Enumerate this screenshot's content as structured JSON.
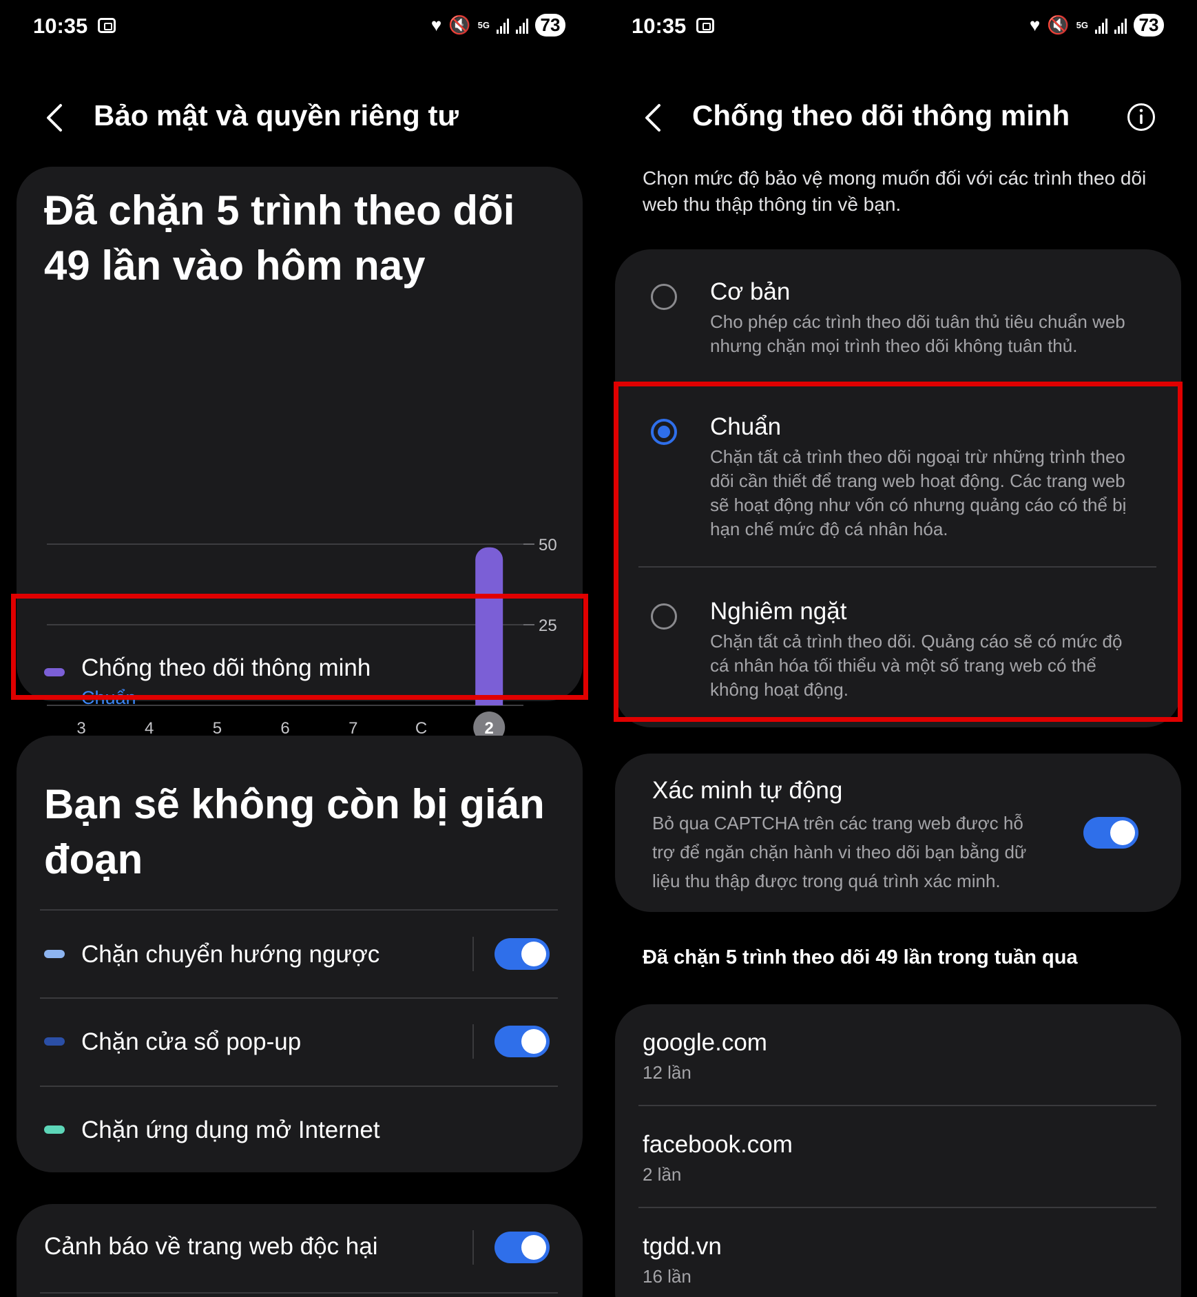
{
  "status": {
    "time": "10:35",
    "battery": "73",
    "network": "5G"
  },
  "left": {
    "header_title": "Bảo mật và quyền riêng tư",
    "card1": {
      "title": "Đã chặn 5 trình theo dõi 49 lần vào hôm nay",
      "feature_label": "Chống theo dõi thông minh",
      "feature_value": "Chuẩn"
    },
    "card2": {
      "title": "Bạn sẽ không còn bị gián đoạn",
      "items": [
        {
          "label": "Chặn chuyển hướng ngược",
          "color": "#8db4f0",
          "toggle": true
        },
        {
          "label": "Chặn cửa sổ pop-up",
          "color": "#2b4fa6",
          "toggle": true
        },
        {
          "label": "Chặn ứng dụng mở Internet",
          "color": "#5dd6b8"
        }
      ]
    },
    "card3": {
      "label": "Cảnh báo về trang web độc hại",
      "toggle": true
    }
  },
  "chart_data": {
    "type": "bar",
    "categories": [
      "3",
      "4",
      "5",
      "6",
      "7",
      "C",
      "2"
    ],
    "values": [
      0,
      0,
      0,
      0,
      0,
      0,
      49
    ],
    "highlighted_category": "2",
    "yticks": [
      25,
      50
    ],
    "ylim": [
      0,
      50
    ],
    "bar_color": "#7b5fd6",
    "grid": true
  },
  "right": {
    "header_title": "Chống theo dõi thông minh",
    "description": "Chọn mức độ bảo vệ mong muốn đối với các trình theo dõi web thu thập thông tin về bạn.",
    "options": [
      {
        "title": "Cơ bản",
        "desc": "Cho phép các trình theo dõi tuân thủ tiêu chuẩn web nhưng chặn mọi trình theo dõi không tuân thủ.",
        "selected": false
      },
      {
        "title": "Chuẩn",
        "desc": "Chặn tất cả trình theo dõi ngoại trừ những trình theo dõi cần thiết để trang web hoạt động. Các trang web sẽ hoạt động như vốn có nhưng quảng cáo có thể bị hạn chế mức độ cá nhân hóa.",
        "selected": true
      },
      {
        "title": "Nghiêm ngặt",
        "desc": "Chặn tất cả trình theo dõi. Quảng cáo sẽ có mức độ cá nhân hóa tối thiểu và một số trang web có thể không hoạt động.",
        "selected": false
      }
    ],
    "auto_verify": {
      "title": "Xác minh tự động",
      "desc": "Bỏ qua CAPTCHA trên các trang web được hỗ trợ để ngăn chặn hành vi theo dõi bạn bằng dữ liệu thu thập được trong quá trình xác minh.",
      "toggle": true
    },
    "week_heading": "Đã chặn 5 trình theo dõi 49 lần trong tuần qua",
    "sites": [
      {
        "domain": "google.com",
        "count": "12 lần"
      },
      {
        "domain": "facebook.com",
        "count": "2 lần"
      },
      {
        "domain": "tgdd.vn",
        "count": "16 lần"
      }
    ]
  }
}
